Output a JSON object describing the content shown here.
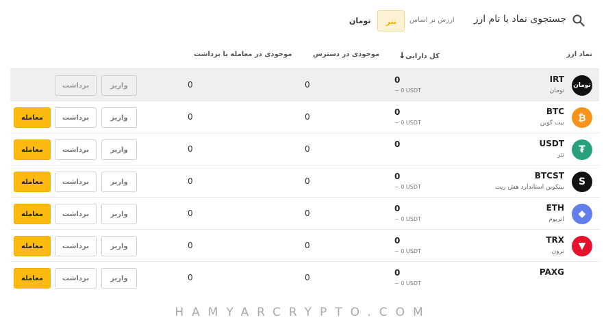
{
  "topbar": {
    "search_placeholder": "جستجوی نماد یا نام ارز",
    "value_basis_label": "ارزش بر اساس",
    "currency_options": [
      "تتر",
      "تومان"
    ],
    "selected_currency": "تتر"
  },
  "table": {
    "headers": {
      "symbol": "نماد ارز",
      "total": "کل دارایی",
      "available": "موجودی در دسترس",
      "in_trade": "موجودی در معامله یا برداشت"
    },
    "deposit_label": "واریز",
    "withdraw_label": "برداشت",
    "trade_label": "معامله",
    "rows": [
      {
        "symbol": "IRT",
        "name": "تومان",
        "total": "0",
        "total_usdt": "~ 0 USDT",
        "available": "0",
        "in_trade": "0",
        "icon": "toman-icon",
        "icon_text": "تومان",
        "color": "#111111"
      },
      {
        "symbol": "BTC",
        "name": "بیت کوین",
        "total": "0",
        "total_usdt": "~ 0 USDT",
        "available": "0",
        "in_trade": "0",
        "icon": "bitcoin-icon",
        "icon_text": "₿",
        "color": "#f7931a"
      },
      {
        "symbol": "USDT",
        "name": "تتر",
        "total": "0",
        "total_usdt": "",
        "available": "0",
        "in_trade": "0",
        "icon": "tether-icon",
        "icon_text": "₮",
        "color": "#26a17b"
      },
      {
        "symbol": "BTCST",
        "name": "بیتکوین استاندارد هش ریت",
        "total": "0",
        "total_usdt": "~ 0 USDT",
        "available": "0",
        "in_trade": "0",
        "icon": "btcst-icon",
        "icon_text": "S",
        "color": "#111111"
      },
      {
        "symbol": "ETH",
        "name": "اتریوم",
        "total": "0",
        "total_usdt": "~ 0 USDT",
        "available": "0",
        "in_trade": "0",
        "icon": "ethereum-icon",
        "icon_text": "◆",
        "color": "#627eea"
      },
      {
        "symbol": "TRX",
        "name": "ترون",
        "total": "0",
        "total_usdt": "~ 0 USDT",
        "available": "0",
        "in_trade": "0",
        "icon": "tron-icon",
        "icon_text": "▼",
        "color": "#e5112d"
      },
      {
        "symbol": "PAXG",
        "name": "",
        "total": "0",
        "total_usdt": "~ 0 USDT",
        "available": "0",
        "in_trade": "0",
        "icon": "paxg-icon",
        "icon_text": "",
        "color": "#ffffff"
      }
    ]
  },
  "watermark": "HAMYARCRYPTO.COM"
}
